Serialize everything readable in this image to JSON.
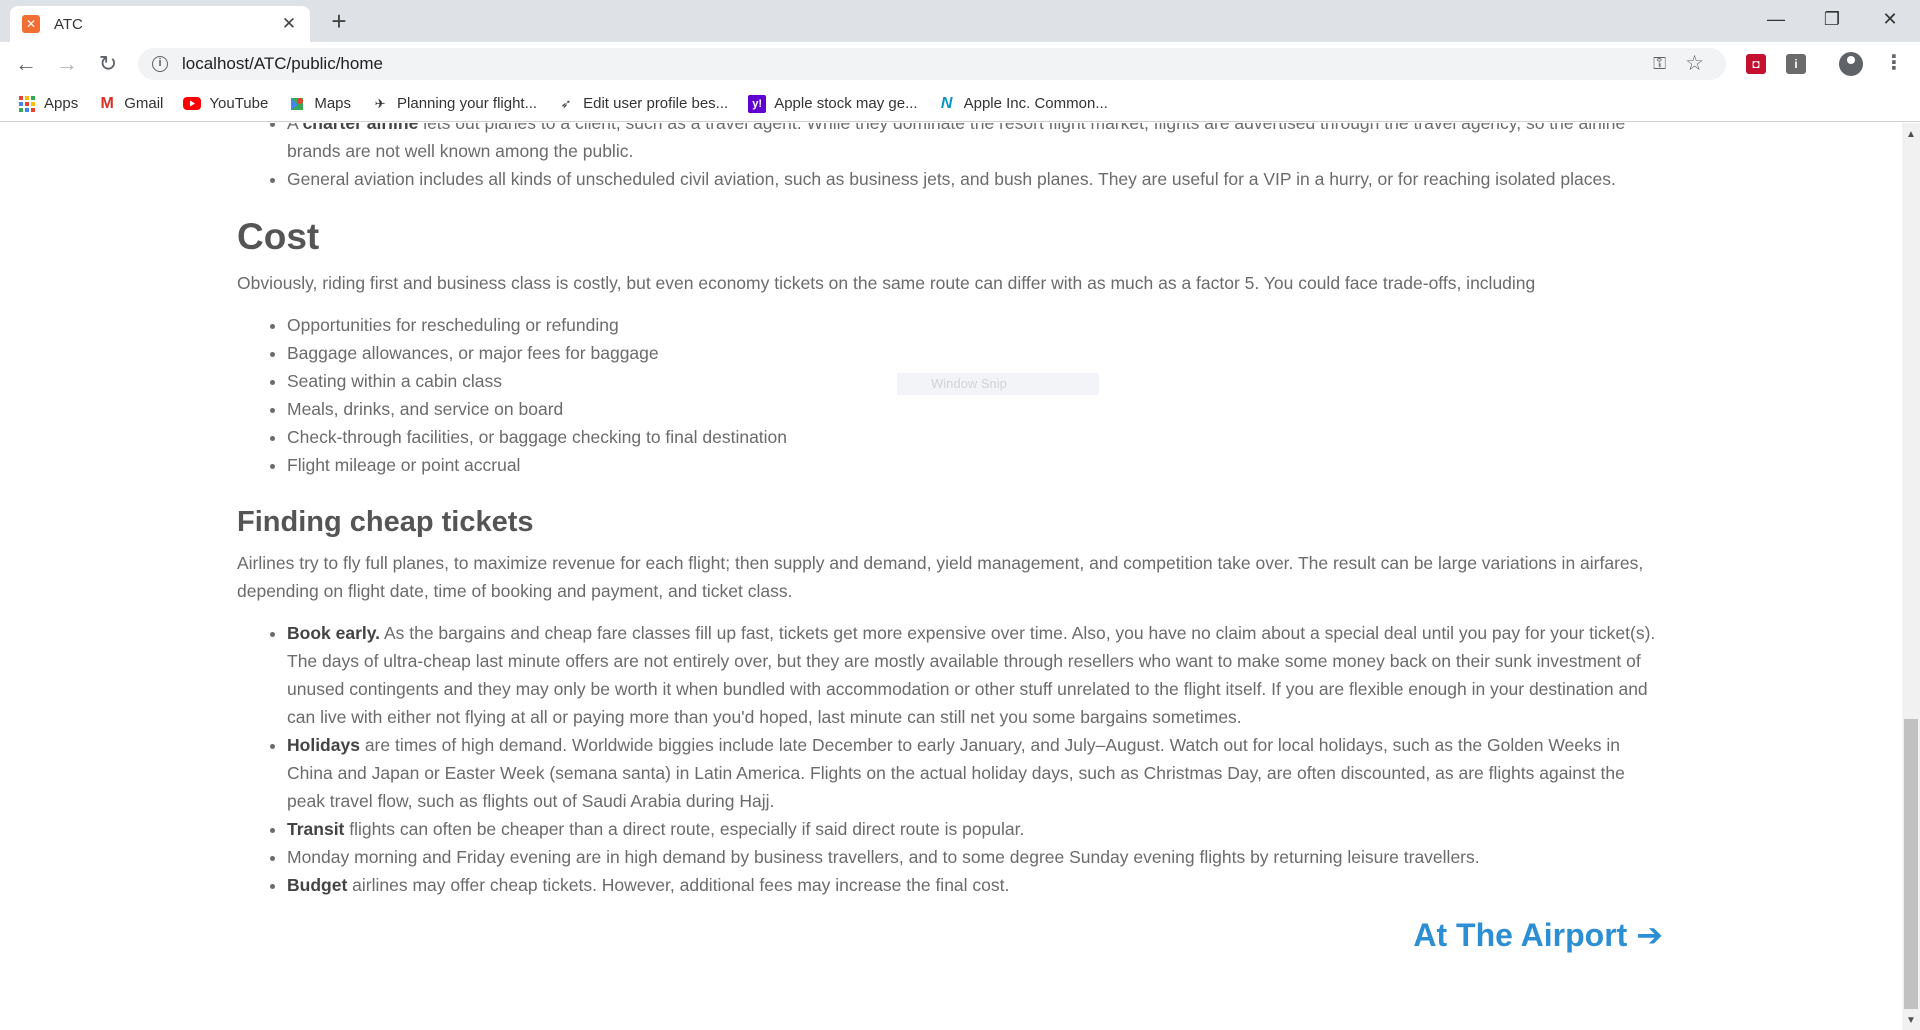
{
  "browser": {
    "tab_title": "ATC",
    "tab_close": "✕",
    "new_tab": "+",
    "url": "localhost/ATC/public/home",
    "window_controls": {
      "minimize": "—",
      "restore": "❐",
      "close": "✕"
    }
  },
  "bookmarks": [
    {
      "label": "Apps",
      "icon": "apps-grid-icon"
    },
    {
      "label": "Gmail",
      "icon": "gmail-icon"
    },
    {
      "label": "YouTube",
      "icon": "youtube-icon"
    },
    {
      "label": "Maps",
      "icon": "maps-icon"
    },
    {
      "label": "Planning your flight...",
      "icon": "flight-icon"
    },
    {
      "label": "Edit user profile bes...",
      "icon": "paper-plane-icon"
    },
    {
      "label": "Apple stock may ge...",
      "icon": "yahoo-icon"
    },
    {
      "label": "Apple Inc. Common...",
      "icon": "nasdaq-icon"
    }
  ],
  "content": {
    "intro_bullets": [
      {
        "bold": "charter airline",
        "prefix": "A ",
        "text": " lets out planes to a client, such as a travel agent. While they dominate the resort flight market, flights are advertised through the travel agency, so the airline brands are not well known among the public."
      },
      {
        "bold": "",
        "prefix": "",
        "text": "General aviation includes all kinds of unscheduled civil aviation, such as business jets, and bush planes. They are useful for a VIP in a hurry, or for reaching isolated places."
      }
    ],
    "cost_heading": "Cost",
    "cost_paragraph": "Obviously, riding first and business class is costly, but even economy tickets on the same route can differ with as much as a factor 5. You could face trade-offs, including",
    "cost_bullets": [
      "Opportunities for rescheduling or refunding",
      "Baggage allowances, or major fees for baggage",
      "Seating within a cabin class",
      "Meals, drinks, and service on board",
      "Check-through facilities, or baggage checking to final destination",
      "Flight mileage or point accrual"
    ],
    "cheap_heading": "Finding cheap tickets",
    "cheap_paragraph": "Airlines try to fly full planes, to maximize revenue for each flight; then supply and demand, yield management, and competition take over. The result can be large variations in airfares, depending on flight date, time of booking and payment, and ticket class.",
    "cheap_bullets": [
      {
        "bold": "Book early.",
        "text": " As the bargains and cheap fare classes fill up fast, tickets get more expensive over time. Also, you have no claim about a special deal until you pay for your ticket(s). The days of ultra-cheap last minute offers are not entirely over, but they are mostly available through resellers who want to make some money back on their sunk investment of unused contingents and they may only be worth it when bundled with accommodation or other stuff unrelated to the flight itself. If you are flexible enough in your destination and can live with either not flying at all or paying more than you'd hoped, last minute can still net you some bargains sometimes."
      },
      {
        "bold": "Holidays",
        "text": " are times of high demand. Worldwide biggies include late December to early January, and July–August. Watch out for local holidays, such as the Golden Weeks in China and Japan or Easter Week (semana santa) in Latin America. Flights on the actual holiday days, such as Christmas Day, are often discounted, as are flights against the peak travel flow, such as flights out of Saudi Arabia during Hajj."
      },
      {
        "bold": "Transit",
        "text": " flights can often be cheaper than a direct route, especially if said direct route is popular."
      },
      {
        "bold": "",
        "text": "Monday morning and Friday evening are in high demand by business travellers, and to some degree Sunday evening flights by returning leisure travellers."
      },
      {
        "bold": "Budget",
        "text": " airlines may offer cheap tickets. However, additional fees may increase the final cost."
      }
    ],
    "next_link": "At The Airport",
    "next_arrow": "➔",
    "snip_label": "Window Snip"
  },
  "colors": {
    "link": "#2c8fd4",
    "body_text": "#6b6b6b",
    "heading": "#555555"
  }
}
